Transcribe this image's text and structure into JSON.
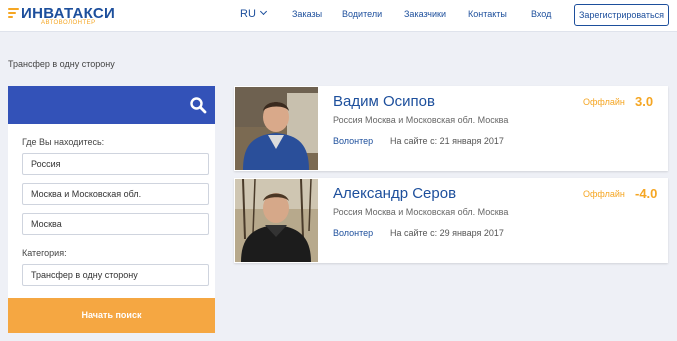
{
  "header": {
    "logo_title": "ИНВАТАКСИ",
    "logo_subtitle": "АВТОВОЛОНТЕР",
    "language": "RU",
    "nav": [
      "Заказы",
      "Водители",
      "Заказчики",
      "Контакты",
      "Вход"
    ],
    "register_label": "Зарегистрироваться"
  },
  "page_title": "Трансфер в одну сторону",
  "sidebar": {
    "location_label": "Где Вы находитесь:",
    "country": "Россия",
    "region": "Москва и Московская обл.",
    "city": "Москва",
    "category_label": "Категория:",
    "category": "Трансфер в одну сторону",
    "submit_label": "Начать поиск"
  },
  "drivers": [
    {
      "name": "Вадим Осипов",
      "status": "Оффлайн",
      "rating": "3.0",
      "location": "Россия Москва и Московская обл. Москва",
      "role": "Волонтер",
      "since": "На сайте с: 21 января 2017"
    },
    {
      "name": "Александр Серов",
      "status": "Оффлайн",
      "rating": "-4.0",
      "location": "Россия Москва и Московская обл. Москва",
      "role": "Волонтер",
      "since": "На сайте с: 29 января 2017"
    }
  ],
  "colors": {
    "brand_blue": "#1d4f9c",
    "search_bar": "#3352b8",
    "accent_orange": "#f5a623",
    "button_orange": "#f5a742",
    "page_bg": "#eef0f6"
  }
}
